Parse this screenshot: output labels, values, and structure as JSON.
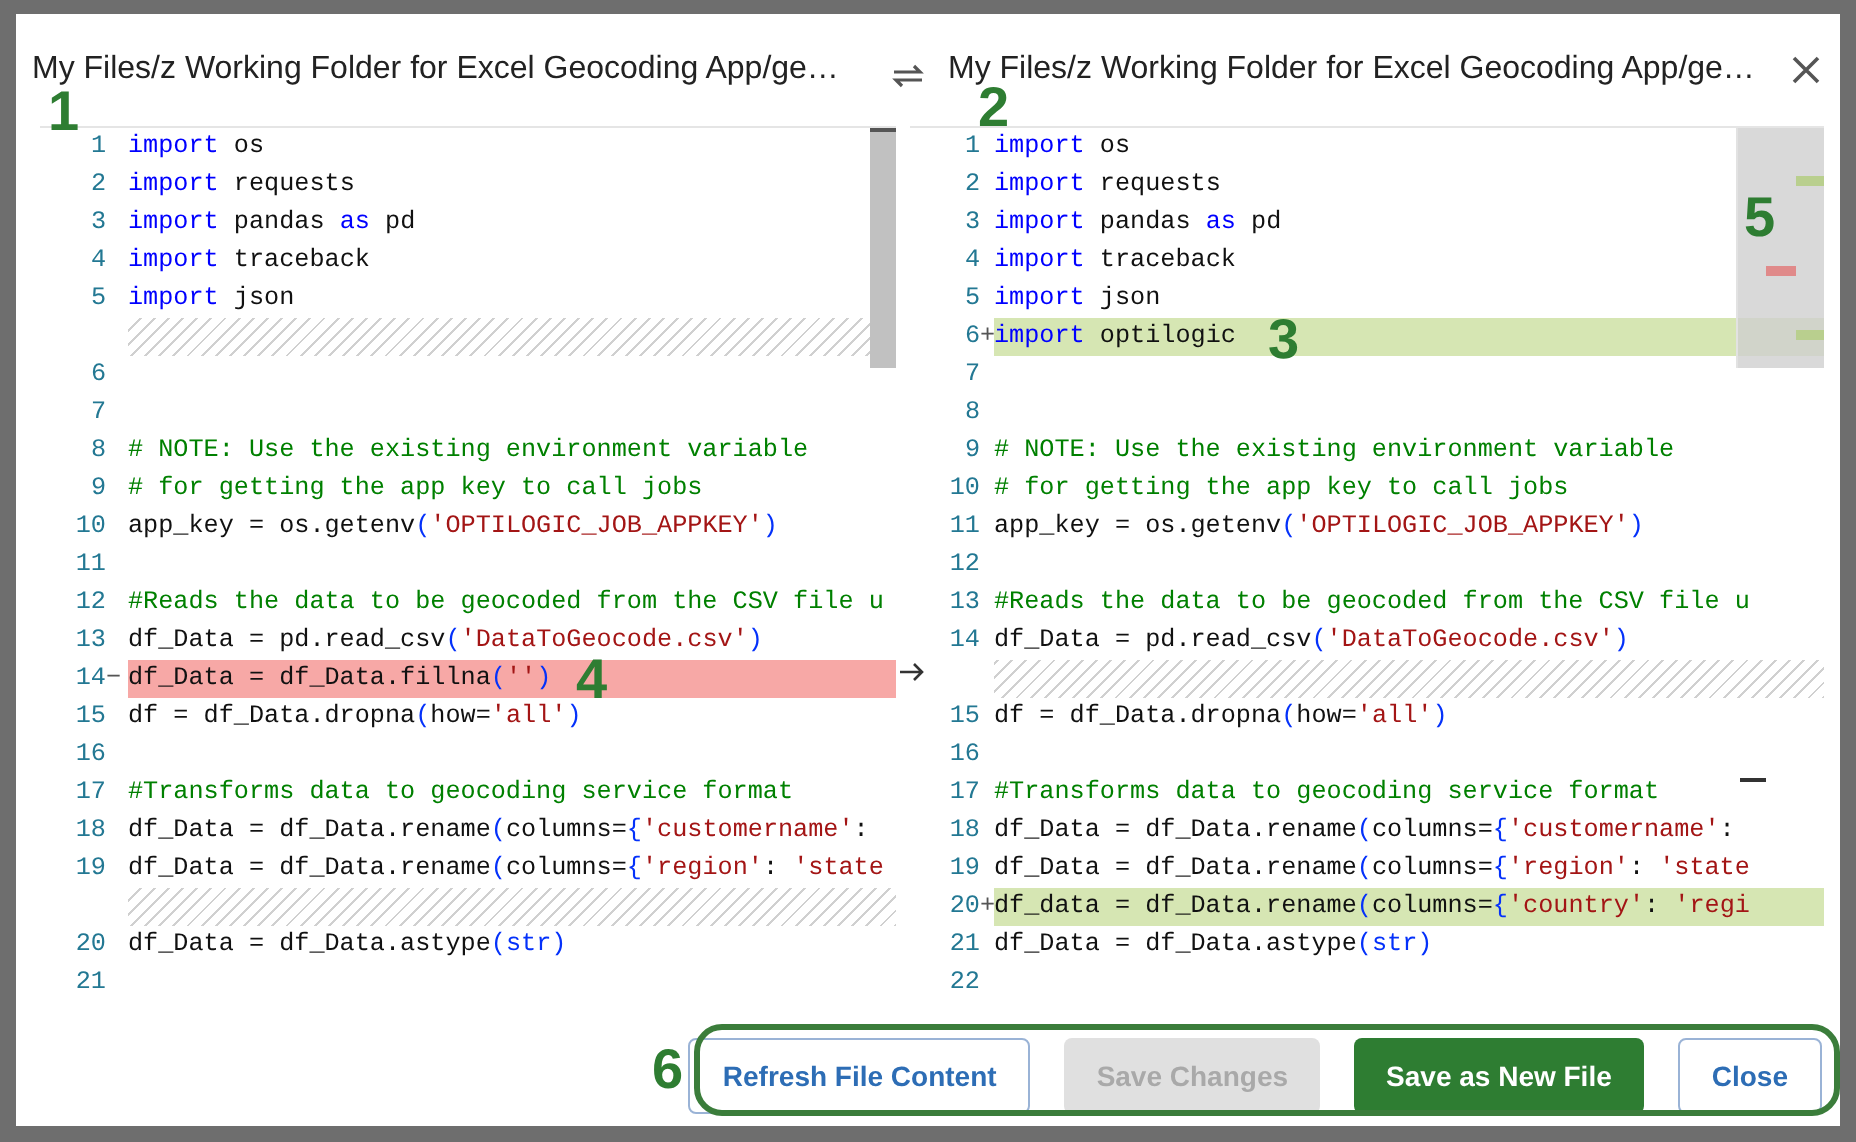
{
  "panes": [
    {
      "title": "My Files/z Working Folder for Excel Geocoding App/ge…",
      "callout": "1",
      "lines": [
        {
          "kind": "normal",
          "n": "1",
          "tokens": [
            {
              "kind": "kw",
              "t": "import"
            },
            {
              "kind": "p",
              "t": " os"
            }
          ]
        },
        {
          "kind": "normal",
          "n": "2",
          "tokens": [
            {
              "kind": "kw",
              "t": "import"
            },
            {
              "kind": "p",
              "t": " requests"
            }
          ]
        },
        {
          "kind": "normal",
          "n": "3",
          "tokens": [
            {
              "kind": "kw",
              "t": "import"
            },
            {
              "kind": "p",
              "t": " pandas "
            },
            {
              "kind": "kw",
              "t": "as"
            },
            {
              "kind": "p",
              "t": " pd"
            }
          ]
        },
        {
          "kind": "normal",
          "n": "4",
          "tokens": [
            {
              "kind": "kw",
              "t": "import"
            },
            {
              "kind": "p",
              "t": " traceback"
            }
          ]
        },
        {
          "kind": "normal",
          "n": "5",
          "tokens": [
            {
              "kind": "kw",
              "t": "import"
            },
            {
              "kind": "p",
              "t": " json"
            }
          ]
        },
        {
          "kind": "filler"
        },
        {
          "kind": "normal",
          "n": "6"
        },
        {
          "kind": "normal",
          "n": "7"
        },
        {
          "kind": "normal",
          "n": "8",
          "tokens": [
            {
              "kind": "c",
              "t": "# NOTE: Use the existing environment variable"
            }
          ]
        },
        {
          "kind": "normal",
          "n": "9",
          "tokens": [
            {
              "kind": "c",
              "t": "# for getting the app key to call jobs"
            }
          ]
        },
        {
          "kind": "normal",
          "n": "10",
          "tokens": [
            {
              "kind": "p",
              "t": "app_key = os.getenv"
            },
            {
              "kind": "b",
              "t": "("
            },
            {
              "kind": "s",
              "t": "'OPTILOGIC_JOB_APPKEY'"
            },
            {
              "kind": "b",
              "t": ")"
            }
          ]
        },
        {
          "kind": "normal",
          "n": "11"
        },
        {
          "kind": "normal",
          "n": "12",
          "tokens": [
            {
              "kind": "c",
              "t": "#Reads the data to be geocoded from the CSV file u"
            }
          ]
        },
        {
          "kind": "normal",
          "n": "13",
          "tokens": [
            {
              "kind": "p",
              "t": "df_Data = pd.read_csv"
            },
            {
              "kind": "b",
              "t": "("
            },
            {
              "kind": "s",
              "t": "'DataToGeocode.csv'"
            },
            {
              "kind": "b",
              "t": ")"
            }
          ]
        },
        {
          "kind": "removed",
          "n": "14",
          "sign": "−",
          "callout": "4",
          "tokens": [
            {
              "kind": "p",
              "t": "df_Data = df_Data.fillna"
            },
            {
              "kind": "b",
              "t": "("
            },
            {
              "kind": "s",
              "t": "''"
            },
            {
              "kind": "b",
              "t": ")"
            }
          ]
        },
        {
          "kind": "normal",
          "n": "15",
          "tokens": [
            {
              "kind": "p",
              "t": "df = df_Data.dropna"
            },
            {
              "kind": "b",
              "t": "("
            },
            {
              "kind": "p",
              "t": "how="
            },
            {
              "kind": "s",
              "t": "'all'"
            },
            {
              "kind": "b",
              "t": ")"
            }
          ]
        },
        {
          "kind": "normal",
          "n": "16"
        },
        {
          "kind": "normal",
          "n": "17",
          "tokens": [
            {
              "kind": "c",
              "t": "#Transforms data to geocoding service format"
            }
          ]
        },
        {
          "kind": "normal",
          "n": "18",
          "tokens": [
            {
              "kind": "p",
              "t": "df_Data = df_Data.rename"
            },
            {
              "kind": "b",
              "t": "("
            },
            {
              "kind": "p",
              "t": "columns="
            },
            {
              "kind": "b",
              "t": "{"
            },
            {
              "kind": "s",
              "t": "'customername'"
            },
            {
              "kind": "p",
              "t": ":"
            }
          ]
        },
        {
          "kind": "normal",
          "n": "19",
          "tokens": [
            {
              "kind": "p",
              "t": "df_Data = df_Data.rename"
            },
            {
              "kind": "b",
              "t": "("
            },
            {
              "kind": "p",
              "t": "columns="
            },
            {
              "kind": "b",
              "t": "{"
            },
            {
              "kind": "s",
              "t": "'region'"
            },
            {
              "kind": "p",
              "t": ": "
            },
            {
              "kind": "s",
              "t": "'state"
            }
          ]
        },
        {
          "kind": "filler"
        },
        {
          "kind": "normal",
          "n": "20",
          "tokens": [
            {
              "kind": "p",
              "t": "df_Data = df_Data.astype"
            },
            {
              "kind": "b",
              "t": "("
            },
            {
              "kind": "b",
              "t": "str"
            },
            {
              "kind": "b",
              "t": ")"
            }
          ]
        },
        {
          "kind": "normal",
          "n": "21"
        }
      ]
    },
    {
      "title": "My Files/z Working Folder for Excel Geocoding App/ge…",
      "callout": "2",
      "ruler_callout": "5",
      "lines": [
        {
          "kind": "normal",
          "n": "1",
          "tokens": [
            {
              "kind": "kw",
              "t": "import"
            },
            {
              "kind": "p",
              "t": " os"
            }
          ]
        },
        {
          "kind": "normal",
          "n": "2",
          "tokens": [
            {
              "kind": "kw",
              "t": "import"
            },
            {
              "kind": "p",
              "t": " requests"
            }
          ]
        },
        {
          "kind": "normal",
          "n": "3",
          "tokens": [
            {
              "kind": "kw",
              "t": "import"
            },
            {
              "kind": "p",
              "t": " pandas "
            },
            {
              "kind": "kw",
              "t": "as"
            },
            {
              "kind": "p",
              "t": " pd"
            }
          ]
        },
        {
          "kind": "normal",
          "n": "4",
          "tokens": [
            {
              "kind": "kw",
              "t": "import"
            },
            {
              "kind": "p",
              "t": " traceback"
            }
          ]
        },
        {
          "kind": "normal",
          "n": "5",
          "tokens": [
            {
              "kind": "kw",
              "t": "import"
            },
            {
              "kind": "p",
              "t": " json"
            }
          ]
        },
        {
          "kind": "added",
          "n": "6",
          "sign": "+",
          "callout": "3",
          "tokens": [
            {
              "kind": "kw",
              "t": "import"
            },
            {
              "kind": "p",
              "t": " optilogic"
            }
          ]
        },
        {
          "kind": "normal",
          "n": "7"
        },
        {
          "kind": "normal",
          "n": "8"
        },
        {
          "kind": "normal",
          "n": "9",
          "tokens": [
            {
              "kind": "c",
              "t": "# NOTE: Use the existing environment variable"
            }
          ]
        },
        {
          "kind": "normal",
          "n": "10",
          "tokens": [
            {
              "kind": "c",
              "t": "# for getting the app key to call jobs"
            }
          ]
        },
        {
          "kind": "normal",
          "n": "11",
          "tokens": [
            {
              "kind": "p",
              "t": "app_key = os.getenv"
            },
            {
              "kind": "b",
              "t": "("
            },
            {
              "kind": "s",
              "t": "'OPTILOGIC_JOB_APPKEY'"
            },
            {
              "kind": "b",
              "t": ")"
            }
          ]
        },
        {
          "kind": "normal",
          "n": "12"
        },
        {
          "kind": "normal",
          "n": "13",
          "tokens": [
            {
              "kind": "c",
              "t": "#Reads the data to be geocoded from the CSV file u"
            }
          ]
        },
        {
          "kind": "normal",
          "n": "14",
          "tokens": [
            {
              "kind": "p",
              "t": "df_Data = pd.read_csv"
            },
            {
              "kind": "b",
              "t": "("
            },
            {
              "kind": "s",
              "t": "'DataToGeocode.csv'"
            },
            {
              "kind": "b",
              "t": ")"
            }
          ]
        },
        {
          "kind": "filler"
        },
        {
          "kind": "normal",
          "n": "15",
          "tokens": [
            {
              "kind": "p",
              "t": "df = df_Data.dropna"
            },
            {
              "kind": "b",
              "t": "("
            },
            {
              "kind": "p",
              "t": "how="
            },
            {
              "kind": "s",
              "t": "'all'"
            },
            {
              "kind": "b",
              "t": ")"
            }
          ]
        },
        {
          "kind": "normal",
          "n": "16"
        },
        {
          "kind": "normal",
          "n": "17",
          "tokens": [
            {
              "kind": "c",
              "t": "#Transforms data to geocoding service format"
            }
          ]
        },
        {
          "kind": "normal",
          "n": "18",
          "tokens": [
            {
              "kind": "p",
              "t": "df_Data = df_Data.rename"
            },
            {
              "kind": "b",
              "t": "("
            },
            {
              "kind": "p",
              "t": "columns="
            },
            {
              "kind": "b",
              "t": "{"
            },
            {
              "kind": "s",
              "t": "'customername'"
            },
            {
              "kind": "p",
              "t": ":"
            }
          ]
        },
        {
          "kind": "normal",
          "n": "19",
          "tokens": [
            {
              "kind": "p",
              "t": "df_Data = df_Data.rename"
            },
            {
              "kind": "b",
              "t": "("
            },
            {
              "kind": "p",
              "t": "columns="
            },
            {
              "kind": "b",
              "t": "{"
            },
            {
              "kind": "s",
              "t": "'region'"
            },
            {
              "kind": "p",
              "t": ": "
            },
            {
              "kind": "s",
              "t": "'state"
            }
          ]
        },
        {
          "kind": "added",
          "n": "20",
          "sign": "+",
          "tokens": [
            {
              "kind": "p",
              "t": "df_data = df_Data.rename"
            },
            {
              "kind": "b",
              "t": "("
            },
            {
              "kind": "p",
              "t": "columns="
            },
            {
              "kind": "b",
              "t": "{"
            },
            {
              "kind": "s",
              "t": "'country'"
            },
            {
              "kind": "p",
              "t": ": "
            },
            {
              "kind": "s",
              "t": "'regi"
            }
          ]
        },
        {
          "kind": "normal",
          "n": "21",
          "tokens": [
            {
              "kind": "p",
              "t": "df_Data = df_Data.astype"
            },
            {
              "kind": "b",
              "t": "("
            },
            {
              "kind": "b",
              "t": "str"
            },
            {
              "kind": "b",
              "t": ")"
            }
          ]
        },
        {
          "kind": "normal",
          "n": "22"
        }
      ]
    }
  ],
  "buttons_callout": "6",
  "buttons": [
    {
      "label": "Refresh File Content",
      "kind": "secondary",
      "disabled": false
    },
    {
      "label": "Save Changes",
      "kind": "primary",
      "disabled": true
    },
    {
      "label": "Save as New File",
      "kind": "primary",
      "disabled": false
    },
    {
      "label": "Close",
      "kind": "secondary",
      "disabled": false
    }
  ]
}
